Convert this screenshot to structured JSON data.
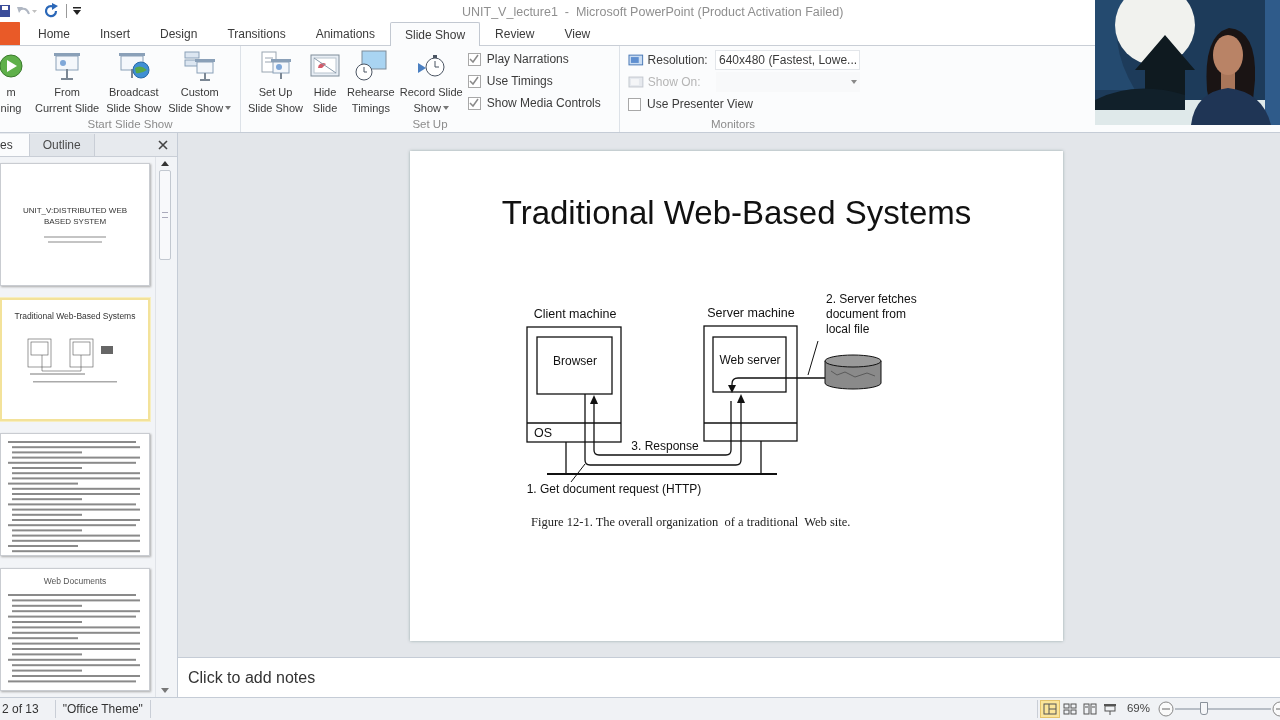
{
  "title_bar": {
    "title": "UNIT_V_lecture1  -  Microsoft PowerPoint (Product Activation Failed)"
  },
  "ribbon_tabs": [
    {
      "label": "Home",
      "selected": false
    },
    {
      "label": "Insert",
      "selected": false
    },
    {
      "label": "Design",
      "selected": false
    },
    {
      "label": "Transitions",
      "selected": false
    },
    {
      "label": "Animations",
      "selected": false
    },
    {
      "label": "Slide Show",
      "selected": true
    },
    {
      "label": "Review",
      "selected": false
    },
    {
      "label": "View",
      "selected": false
    }
  ],
  "start_group": {
    "label": "Start Slide Show",
    "buttons": [
      {
        "lines": [
          "m",
          "ning"
        ],
        "dropdown": false
      },
      {
        "lines": [
          "From",
          "Current Slide"
        ],
        "dropdown": false
      },
      {
        "lines": [
          "Broadcast",
          "Slide Show"
        ],
        "dropdown": false
      },
      {
        "lines": [
          "Custom",
          "Slide Show"
        ],
        "dropdown": true
      }
    ]
  },
  "setup_group": {
    "label": "Set Up",
    "buttons": [
      {
        "lines": [
          "Set Up",
          "Slide Show"
        ],
        "dropdown": false
      },
      {
        "lines": [
          "Hide",
          "Slide"
        ],
        "dropdown": false
      },
      {
        "lines": [
          "Rehearse",
          "Timings"
        ],
        "dropdown": false
      },
      {
        "lines": [
          "Record Slide",
          "Show"
        ],
        "dropdown": true
      }
    ],
    "checkboxes": [
      {
        "label": "Play Narrations",
        "checked": true
      },
      {
        "label": "Use Timings",
        "checked": true
      },
      {
        "label": "Show Media Controls",
        "checked": true
      }
    ]
  },
  "monitors_group": {
    "label": "Monitors",
    "fields": [
      {
        "label": "Resolution:",
        "value": "640x480 (Fastest, Lowe...",
        "disabled": false
      },
      {
        "label": "Show On:",
        "disabled": true
      }
    ],
    "presenter_view": {
      "label": "Use Presenter View",
      "checked": false
    }
  },
  "left_pane": {
    "tabs": [
      {
        "label": "es",
        "selected": true
      },
      {
        "label": "Outline",
        "selected": false
      }
    ],
    "thumbnails": [
      {
        "kind": "title",
        "title": "UNIT_V:DISTRIBUTED WEB BASED SYSTEM",
        "selected": false
      },
      {
        "kind": "diagram",
        "title": "Traditional Web-Based Systems",
        "selected": true
      },
      {
        "kind": "bullets",
        "selected": false
      },
      {
        "kind": "bullets",
        "title": "Web Documents",
        "selected": false
      }
    ]
  },
  "slide": {
    "title": "Traditional Web-Based Systems",
    "diagram": {
      "client_label": "Client machine",
      "browser_label": "Browser",
      "os_label": "OS",
      "server_label": "Server machine",
      "web_server_label": "Web server",
      "fetch_note": [
        "2. Server fetches",
        "document from",
        "local file"
      ],
      "response_label": "3. Response",
      "request_label": "1. Get document request (HTTP)"
    },
    "caption": "Figure 12-1. The overall organization  of a traditional  Web site."
  },
  "notes": {
    "placeholder": "Click to add notes"
  },
  "status_bar": {
    "slide_counter": "2 of 13",
    "theme": "\"Office Theme\"",
    "views": [
      {
        "kind": "normal",
        "selected": true
      },
      {
        "kind": "sorter",
        "selected": false
      },
      {
        "kind": "reading",
        "selected": false
      },
      {
        "kind": "slideshow",
        "selected": false
      }
    ],
    "zoom": "69%",
    "zoom_slider": {
      "level": 0.3
    }
  }
}
